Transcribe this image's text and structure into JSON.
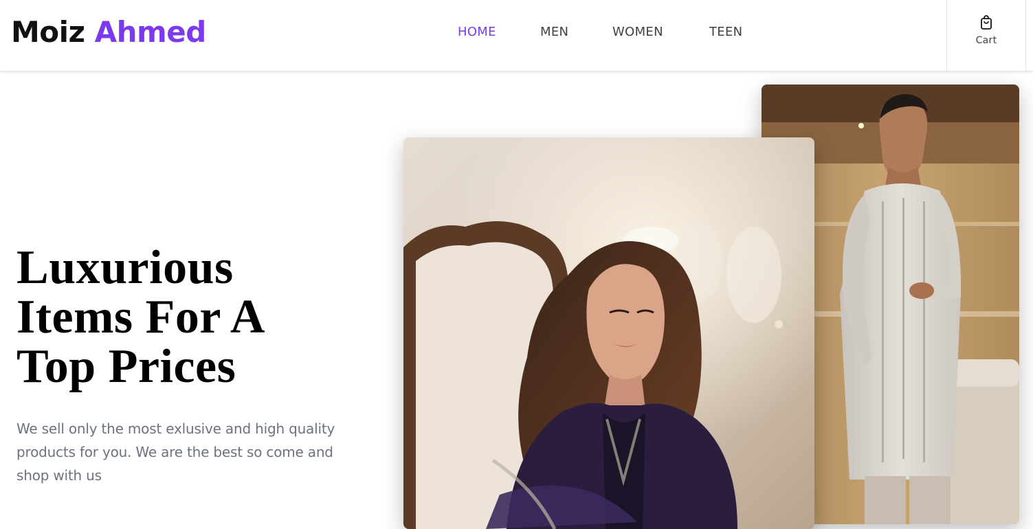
{
  "header": {
    "logo": {
      "first": "Moiz",
      "second": "Ahmed"
    },
    "nav": [
      {
        "label": "HOME",
        "active": true
      },
      {
        "label": "MEN",
        "active": false
      },
      {
        "label": "WOMEN",
        "active": false
      },
      {
        "label": "TEEN",
        "active": false
      }
    ],
    "cart": {
      "icon": "shopping-bag-icon",
      "label": "Cart"
    }
  },
  "hero": {
    "title_lines": [
      "Luxurious",
      "Items For A",
      "Top Prices"
    ],
    "description": "We sell only the most exlusive and high quality products for you. We are the best so come and shop with us"
  },
  "images": {
    "women": {
      "subject": "woman in embroidered dark velvet outfit"
    },
    "men": {
      "subject": "man in light embroidered kurta"
    }
  },
  "colors": {
    "accent": "#7c3aed",
    "text_dark": "#111111",
    "nav_text": "#3f3f46",
    "body_text": "#6b7280"
  }
}
